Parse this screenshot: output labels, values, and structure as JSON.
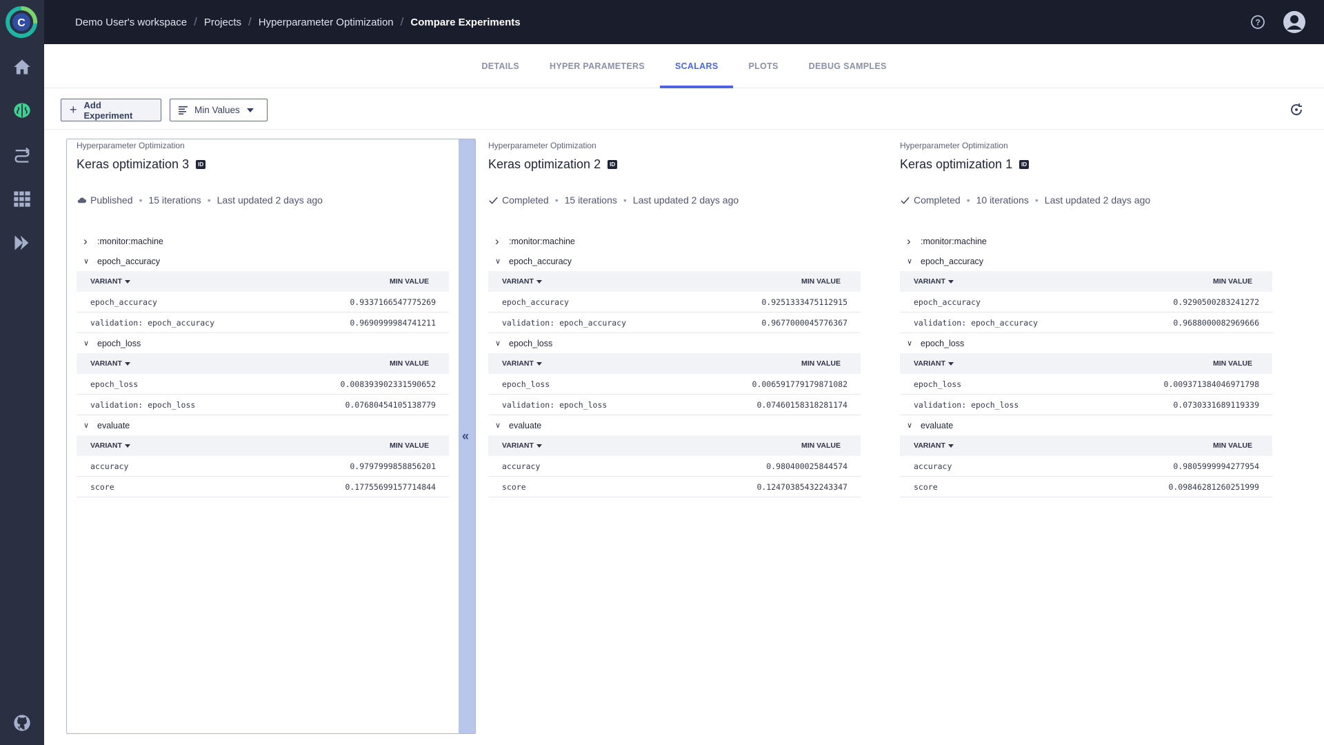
{
  "breadcrumb": [
    "Demo User's workspace",
    "Projects",
    "Hyperparameter Optimization",
    "Compare Experiments"
  ],
  "tabs": [
    {
      "label": "DETAILS",
      "active": false
    },
    {
      "label": "HYPER PARAMETERS",
      "active": false
    },
    {
      "label": "SCALARS",
      "active": true
    },
    {
      "label": "PLOTS",
      "active": false
    },
    {
      "label": "DEBUG SAMPLES",
      "active": false
    }
  ],
  "toolbar": {
    "add_label": "Add Experiment",
    "min_values_label": "Min Values"
  },
  "colors": {
    "accent": "#4d66e0",
    "sidebar": "#2a3042",
    "topbar": "#1a1e2c"
  },
  "experiments": [
    {
      "project": "Hyperparameter Optimization",
      "name": "Keras optimization 3",
      "id_badge": "ID",
      "status_icon": "cloud-icon",
      "status": "Published",
      "iterations": "15 iterations",
      "updated": "Last updated 2 days ago",
      "groups": [
        {
          "name": ":monitor:machine",
          "expanded": false
        },
        {
          "name": "epoch_accuracy",
          "expanded": true,
          "variant_header": "VARIANT",
          "value_header": "MIN VALUE",
          "rows": [
            [
              "epoch_accuracy",
              "0.9337166547775269"
            ],
            [
              "validation: epoch_accuracy",
              "0.9690999984741211"
            ]
          ]
        },
        {
          "name": "epoch_loss",
          "expanded": true,
          "variant_header": "VARIANT",
          "value_header": "MIN VALUE",
          "rows": [
            [
              "epoch_loss",
              "0.008393902331590652"
            ],
            [
              "validation: epoch_loss",
              "0.07680454105138779"
            ]
          ]
        },
        {
          "name": "evaluate",
          "expanded": true,
          "variant_header": "VARIANT",
          "value_header": "MIN VALUE",
          "rows": [
            [
              "accuracy",
              "0.9797999858856201"
            ],
            [
              "score",
              "0.17755699157714844"
            ]
          ]
        }
      ]
    },
    {
      "project": "Hyperparameter Optimization",
      "name": "Keras optimization 2",
      "id_badge": "ID",
      "status_icon": "check-icon",
      "status": "Completed",
      "iterations": "15 iterations",
      "updated": "Last updated 2 days ago",
      "groups": [
        {
          "name": ":monitor:machine",
          "expanded": false
        },
        {
          "name": "epoch_accuracy",
          "expanded": true,
          "variant_header": "VARIANT",
          "value_header": "MIN VALUE",
          "rows": [
            [
              "epoch_accuracy",
              "0.9251333475112915"
            ],
            [
              "validation: epoch_accuracy",
              "0.9677000045776367"
            ]
          ]
        },
        {
          "name": "epoch_loss",
          "expanded": true,
          "variant_header": "VARIANT",
          "value_header": "MIN VALUE",
          "rows": [
            [
              "epoch_loss",
              "0.006591779179871082"
            ],
            [
              "validation: epoch_loss",
              "0.07460158318281174"
            ]
          ]
        },
        {
          "name": "evaluate",
          "expanded": true,
          "variant_header": "VARIANT",
          "value_header": "MIN VALUE",
          "rows": [
            [
              "accuracy",
              "0.980400025844574"
            ],
            [
              "score",
              "0.12470385432243347"
            ]
          ]
        }
      ]
    },
    {
      "project": "Hyperparameter Optimization",
      "name": "Keras optimization 1",
      "id_badge": "ID",
      "status_icon": "check-icon",
      "status": "Completed",
      "iterations": "10 iterations",
      "updated": "Last updated 2 days ago",
      "groups": [
        {
          "name": ":monitor:machine",
          "expanded": false
        },
        {
          "name": "epoch_accuracy",
          "expanded": true,
          "variant_header": "VARIANT",
          "value_header": "MIN VALUE",
          "rows": [
            [
              "epoch_accuracy",
              "0.9290500283241272"
            ],
            [
              "validation: epoch_accuracy",
              "0.9688000082969666"
            ]
          ]
        },
        {
          "name": "epoch_loss",
          "expanded": true,
          "variant_header": "VARIANT",
          "value_header": "MIN VALUE",
          "rows": [
            [
              "epoch_loss",
              "0.009371384046971798"
            ],
            [
              "validation: epoch_loss",
              "0.0730331689119339"
            ]
          ]
        },
        {
          "name": "evaluate",
          "expanded": true,
          "variant_header": "VARIANT",
          "value_header": "MIN VALUE",
          "rows": [
            [
              "accuracy",
              "0.9805999994277954"
            ],
            [
              "score",
              "0.09846281260251999"
            ]
          ]
        }
      ]
    }
  ]
}
